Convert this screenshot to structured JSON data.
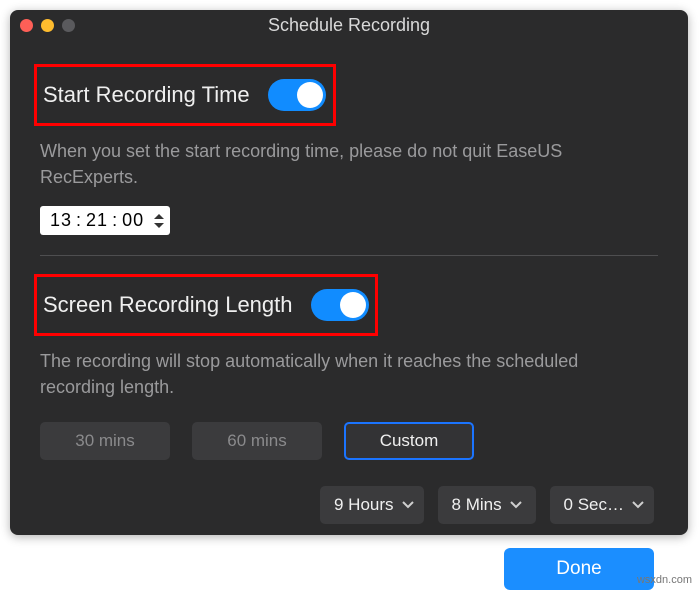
{
  "window": {
    "title": "Schedule Recording"
  },
  "start_time": {
    "label": "Start Recording Time",
    "enabled": true,
    "description": "When you set the start recording time, please do not quit EaseUS RecExperts.",
    "hh": "13",
    "mm": "21",
    "ss": "00"
  },
  "length": {
    "label": "Screen Recording Length",
    "enabled": true,
    "description": "The recording will stop automatically when it reaches the scheduled recording length.",
    "presets": {
      "opt30": "30 mins",
      "opt60": "60 mins",
      "custom": "Custom",
      "selected": "custom"
    },
    "custom": {
      "hours": "9 Hours",
      "mins": "8 Mins",
      "secs": "0 Sec…"
    }
  },
  "footer": {
    "done": "Done"
  },
  "watermark": "wsxdn.com"
}
